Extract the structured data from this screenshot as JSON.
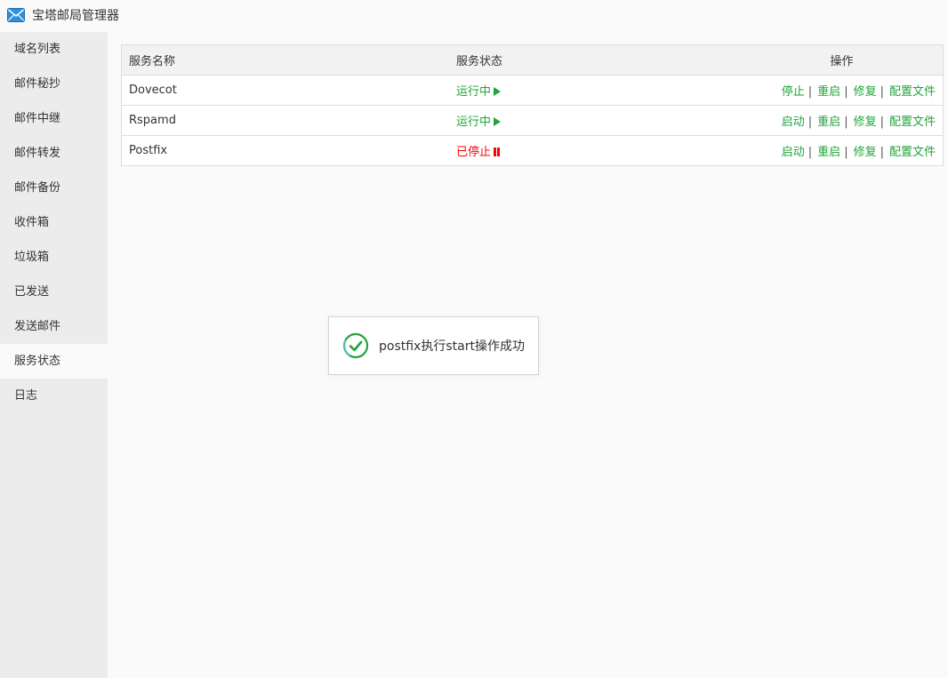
{
  "app": {
    "title": "宝塔邮局管理器"
  },
  "sidebar": {
    "items": [
      {
        "label": "域名列表"
      },
      {
        "label": "邮件秘抄"
      },
      {
        "label": "邮件中继"
      },
      {
        "label": "邮件转发"
      },
      {
        "label": "邮件备份"
      },
      {
        "label": "收件箱"
      },
      {
        "label": "垃圾箱"
      },
      {
        "label": "已发送"
      },
      {
        "label": "发送邮件"
      },
      {
        "label": "服务状态",
        "active": true
      },
      {
        "label": "日志"
      }
    ]
  },
  "table": {
    "headers": {
      "name": "服务名称",
      "status": "服务状态",
      "ops": "操作"
    },
    "rows": [
      {
        "name": "Dovecot",
        "status": "运行中",
        "state": "running",
        "ops": [
          "停止",
          "重启",
          "修复",
          "配置文件"
        ]
      },
      {
        "name": "Rspamd",
        "status": "运行中",
        "state": "running",
        "ops": [
          "启动",
          "重启",
          "修复",
          "配置文件"
        ]
      },
      {
        "name": "Postfix",
        "status": "已停止",
        "state": "stopped",
        "ops": [
          "启动",
          "重启",
          "修复",
          "配置文件"
        ]
      }
    ]
  },
  "toast": {
    "message": "postfix执行start操作成功",
    "icon": "check-circle-icon"
  },
  "colors": {
    "accent": "#20a53a",
    "danger": "#ff0000",
    "sidebar_bg": "#ececec"
  }
}
